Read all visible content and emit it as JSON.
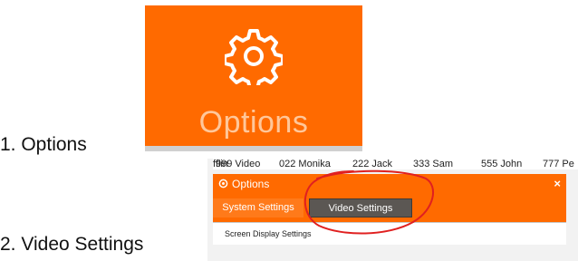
{
  "steps": {
    "step1": "1.   Options",
    "step2": "2.   Video Settings"
  },
  "tile": {
    "label": "Options",
    "icon": "gear-icon",
    "color": "#ff6a00"
  },
  "window": {
    "names": [
      "999 Video",
      "022 Monika",
      "222 Jack",
      "333 Sam",
      "555 John",
      "777 Pe"
    ],
    "names_cut": "fflin",
    "title": "Options",
    "close": "×",
    "tabs": [
      "System Settings",
      "Video Settings"
    ],
    "active_tab": "Video Settings",
    "subtab": "Screen Display Settings",
    "accent": "#ff6a00",
    "annotation_color": "#e02020"
  }
}
